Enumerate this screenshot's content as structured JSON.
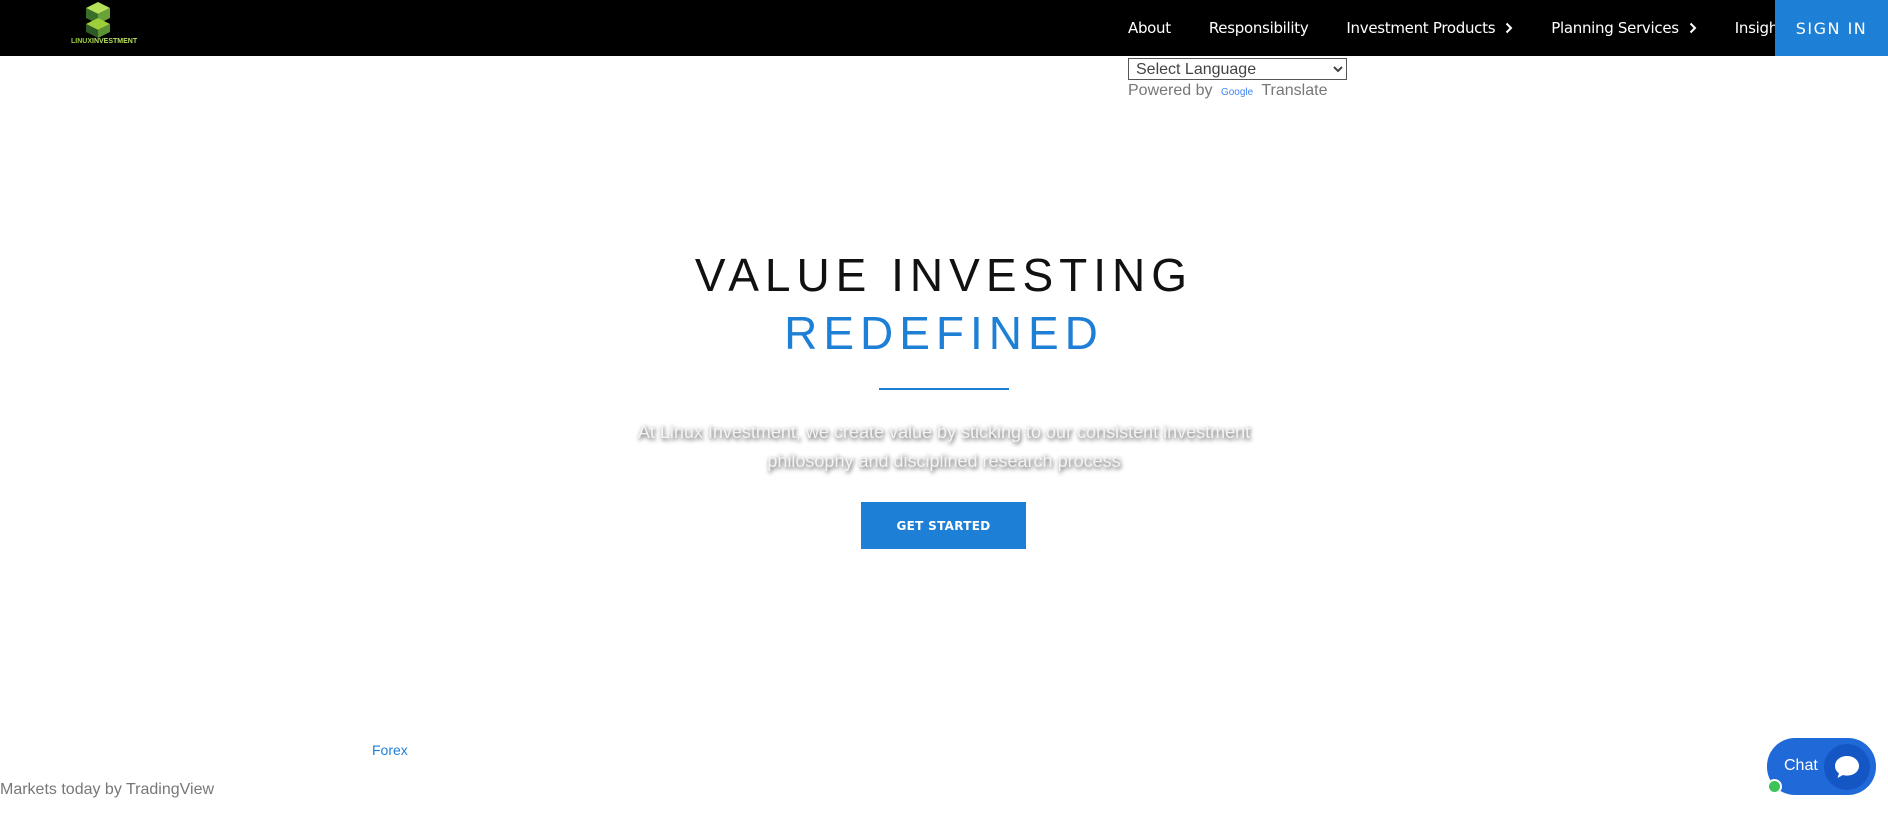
{
  "header": {
    "logo": {
      "brand_part1": "LINUX",
      "brand_part2": "INVESTMENT"
    },
    "nav": [
      {
        "label": "About",
        "has_submenu": false
      },
      {
        "label": "Responsibility",
        "has_submenu": false
      },
      {
        "label": "Investment Products",
        "has_submenu": true
      },
      {
        "label": "Planning Services",
        "has_submenu": true
      },
      {
        "label": "Insight",
        "has_submenu": false
      }
    ],
    "signin_label": "SIGN IN"
  },
  "translate": {
    "selected": "Select Language",
    "powered_by": "Powered by",
    "google": "Google",
    "translate_label": "Translate"
  },
  "hero": {
    "title": "VALUE INVESTING",
    "subtitle": "REDEFINED",
    "description": "At Linux Investment, we create value by sticking to our consistent investment philosophy and disciplined research process",
    "cta_label": "GET STARTED"
  },
  "widgets": {
    "forex_link": "Forex",
    "markets_text": "Markets today by TradingView"
  },
  "chat": {
    "label": "Chat",
    "status": "online"
  },
  "colors": {
    "accent": "#1e7fd6",
    "navbar_bg": "#000000",
    "logo_green": "#9ccf3a",
    "chat_bg": "#1f69d8",
    "online_dot": "#3cc35a"
  },
  "icons": {
    "logo": "cube-logo-icon",
    "submenu": "chevron-right-icon",
    "chat": "chat-bubble-icon"
  }
}
